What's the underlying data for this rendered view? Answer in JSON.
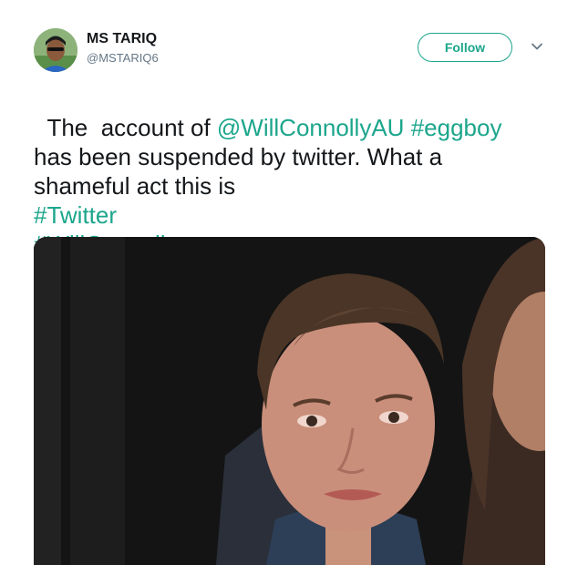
{
  "author": {
    "name": "MS TARIQ",
    "handle": "@MSTARIQ6"
  },
  "actions": {
    "follow_label": "Follow",
    "more_icon": "chevron-down-icon"
  },
  "tweet": {
    "segments": [
      {
        "text": "The  account of ",
        "type": "text"
      },
      {
        "text": "@WillConnollyAU",
        "type": "mention"
      },
      {
        "text": " ",
        "type": "text"
      },
      {
        "text": "#eggboy",
        "type": "hashtag"
      },
      {
        "text": "\nhas been suspended by twitter. What a\nshameful act this is\n",
        "type": "text"
      },
      {
        "text": "#Twitter",
        "type": "hashtag"
      },
      {
        "text": "\n",
        "type": "text"
      },
      {
        "text": "#WillConnolly",
        "type": "hashtag"
      }
    ]
  },
  "colors": {
    "accent": "#1ca68c",
    "text": "#14171a",
    "secondary": "#657786"
  }
}
